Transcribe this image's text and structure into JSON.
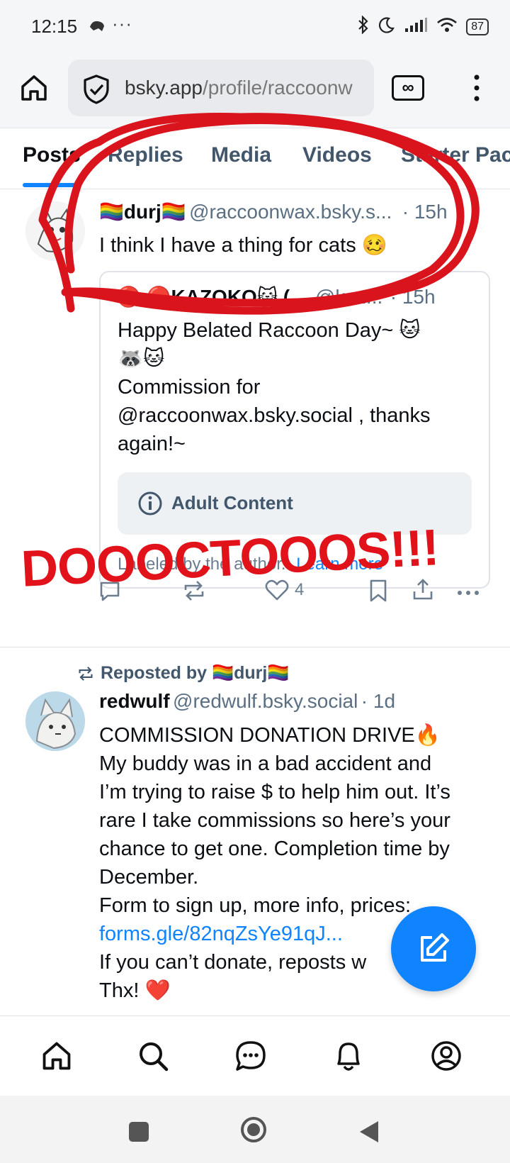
{
  "status_bar": {
    "time": "12:15",
    "extra": "···",
    "battery": "87"
  },
  "browser": {
    "url_host": "bsky.app",
    "url_path": "/profile/raccoonw",
    "tab_switch_glyph": "∞"
  },
  "tabs": [
    {
      "label": "Posts",
      "active": true
    },
    {
      "label": "Replies",
      "active": false
    },
    {
      "label": "Media",
      "active": false
    },
    {
      "label": "Videos",
      "active": false
    },
    {
      "label": "Starter Pac",
      "active": false
    }
  ],
  "post1": {
    "author_name": "🏳️‍🌈durj🏳️‍🌈",
    "handle": "@raccoonwax.bsky.s...",
    "time": "· 15h",
    "text": "I think I have a thing for cats 🥴",
    "quote": {
      "author_name": "🔴 🔴KAZOKO😺 (...",
      "handle": "@kaz...",
      "time": "· 15h",
      "text_line1": "Happy Belated Raccoon Day~ 🐱",
      "text_line2": "🦝🐱",
      "text_line3": "Commission for",
      "text_line4": "@raccoonwax.bsky.social , thanks",
      "text_line5": "again!~",
      "adult_label": "Adult Content",
      "labeled_by": "Labeled by the author.",
      "learn_more": "Learn more"
    },
    "like_count": "4"
  },
  "post2": {
    "repost_label": "Reposted by 🏳️‍🌈durj🏳️‍🌈",
    "author_name": "redwulf",
    "handle": "@redwulf.bsky.social",
    "time": "· 1d",
    "lines": [
      "COMMISSION DONATION DRIVE🔥",
      "My buddy was in a bad accident and",
      "I’m trying to raise $ to help him out. It’s",
      "rare I take commissions so here’s your",
      "chance to get one. Completion time by",
      "December.",
      "Form to sign up, more info, prices:"
    ],
    "link": "forms.gle/82nqZsYe91qJ...",
    "line_after_link": "If you can’t donate, reposts w",
    "last_line": "Thx! ❤️"
  },
  "annotation": {
    "text": "DOOOCTOOOS!!!",
    "color": "#e2121b"
  },
  "colors": {
    "accent": "#1083fe",
    "muted": "#5b6f83"
  }
}
